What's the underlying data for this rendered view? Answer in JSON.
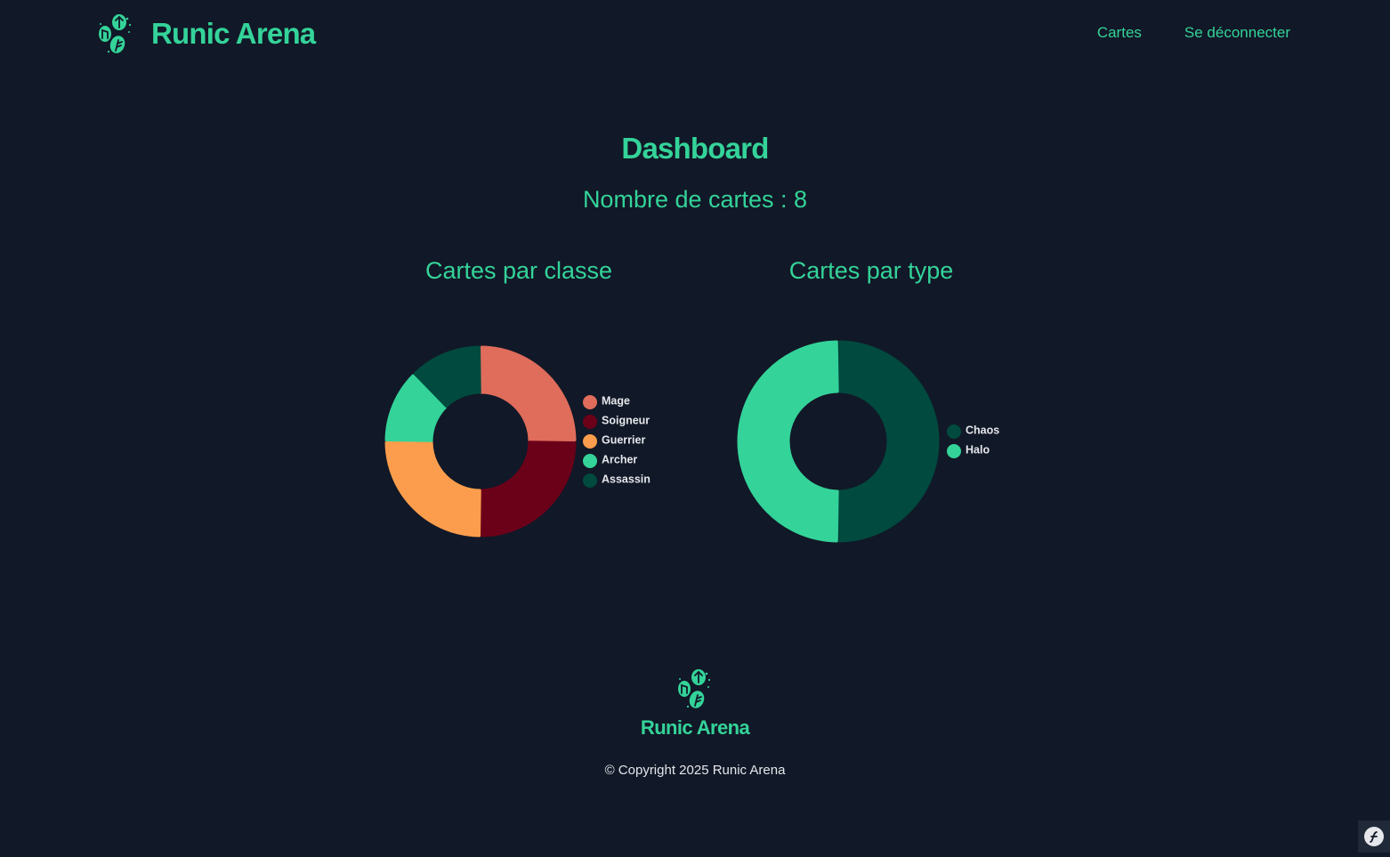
{
  "brand": {
    "name": "Runic Arena",
    "logo_icon": "rune-stones-icon"
  },
  "nav": {
    "items": [
      "Cartes",
      "Se déconnecter"
    ]
  },
  "main": {
    "title": "Dashboard",
    "card_count": "Nombre de cartes : 8"
  },
  "colors": {
    "accent": "#34d399",
    "background": "#111827"
  },
  "chart_data": [
    {
      "type": "pie",
      "title": "Cartes par classe",
      "categories": [
        "Mage",
        "Soigneur",
        "Guerrier",
        "Archer",
        "Assassin"
      ],
      "values": [
        2,
        2,
        2,
        1,
        1
      ],
      "colors": [
        "#e06c5b",
        "#6b0019",
        "#fb9d4c",
        "#34d399",
        "#004a3f"
      ],
      "legend": "right"
    },
    {
      "type": "pie",
      "title": "Cartes par type",
      "categories": [
        "Chaos",
        "Halo"
      ],
      "values": [
        4,
        4
      ],
      "colors": [
        "#004a3f",
        "#34d399"
      ],
      "legend": "right"
    }
  ],
  "footer": {
    "name": "Runic Arena",
    "copyright": "© Copyright 2025 Runic Arena",
    "logo_icon": "rune-stones-icon"
  },
  "badge": {
    "icon": "symfony-icon"
  }
}
